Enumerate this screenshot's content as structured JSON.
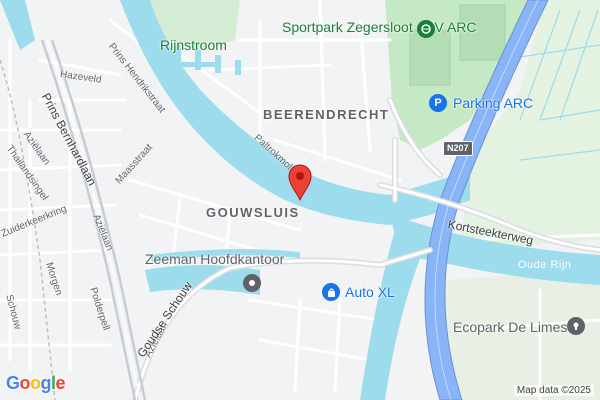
{
  "map": {
    "districts": {
      "beerendrecht": "BEERENDRECHT",
      "gouwsluis": "GOUWSLUIS"
    },
    "pois": {
      "sportpark": "Sportpark Zegersloot - SV ARC",
      "parking": "Parking ARC",
      "rijnstroom": "Rijnstroom",
      "zeeman": "Zeeman Hoofdkantoor",
      "autoxl": "Auto XL",
      "ecopark": "Ecopark De Limes"
    },
    "streets": {
      "hazeveld": "Hazeveld",
      "prins_hendrikstraat": "Prins Hendrikstraat",
      "maasstraat": "Maasstraat",
      "prins_bernhardlaan": "Prins Bernhardlaan",
      "azielaan_1": "Aziëlaan",
      "azielaan_2": "Aziëlaan",
      "azielaan_3": "Aziëlaan",
      "thailandsingel": "Thailandsingel",
      "zuiderkeerkring": "Zuiderkeerkring",
      "morgen": "Morgen",
      "schouw": "Schouw",
      "polderpell": "Polderpell",
      "goudse_schouw": "Goudse Schouw",
      "paltrokmolen": "Paltrokmol",
      "kortsteekterweg": "Kortsteekterweg"
    },
    "water": {
      "oude_rijn": "Oude Rijn"
    },
    "road_shield": "N207",
    "attribution": "Map data ©2025",
    "logo_letters": [
      "G",
      "o",
      "o",
      "g",
      "l",
      "e"
    ],
    "logo_colors": [
      "#4285F4",
      "#EA4335",
      "#FBBC05",
      "#4285F4",
      "#34A853",
      "#EA4335"
    ],
    "colors": {
      "water": "#9cdcec",
      "park": "#c5e8c5",
      "land": "#f1f3f4",
      "highway": "#8ab4f8",
      "highway_edge": "#6e8fcf",
      "pin": "#ea4335"
    },
    "icons": {
      "marker": "red-location-pin",
      "sport": "sports-complex-icon",
      "parking": "parking-icon",
      "shop": "shopping-bag-icon",
      "generic": "place-icon"
    }
  }
}
